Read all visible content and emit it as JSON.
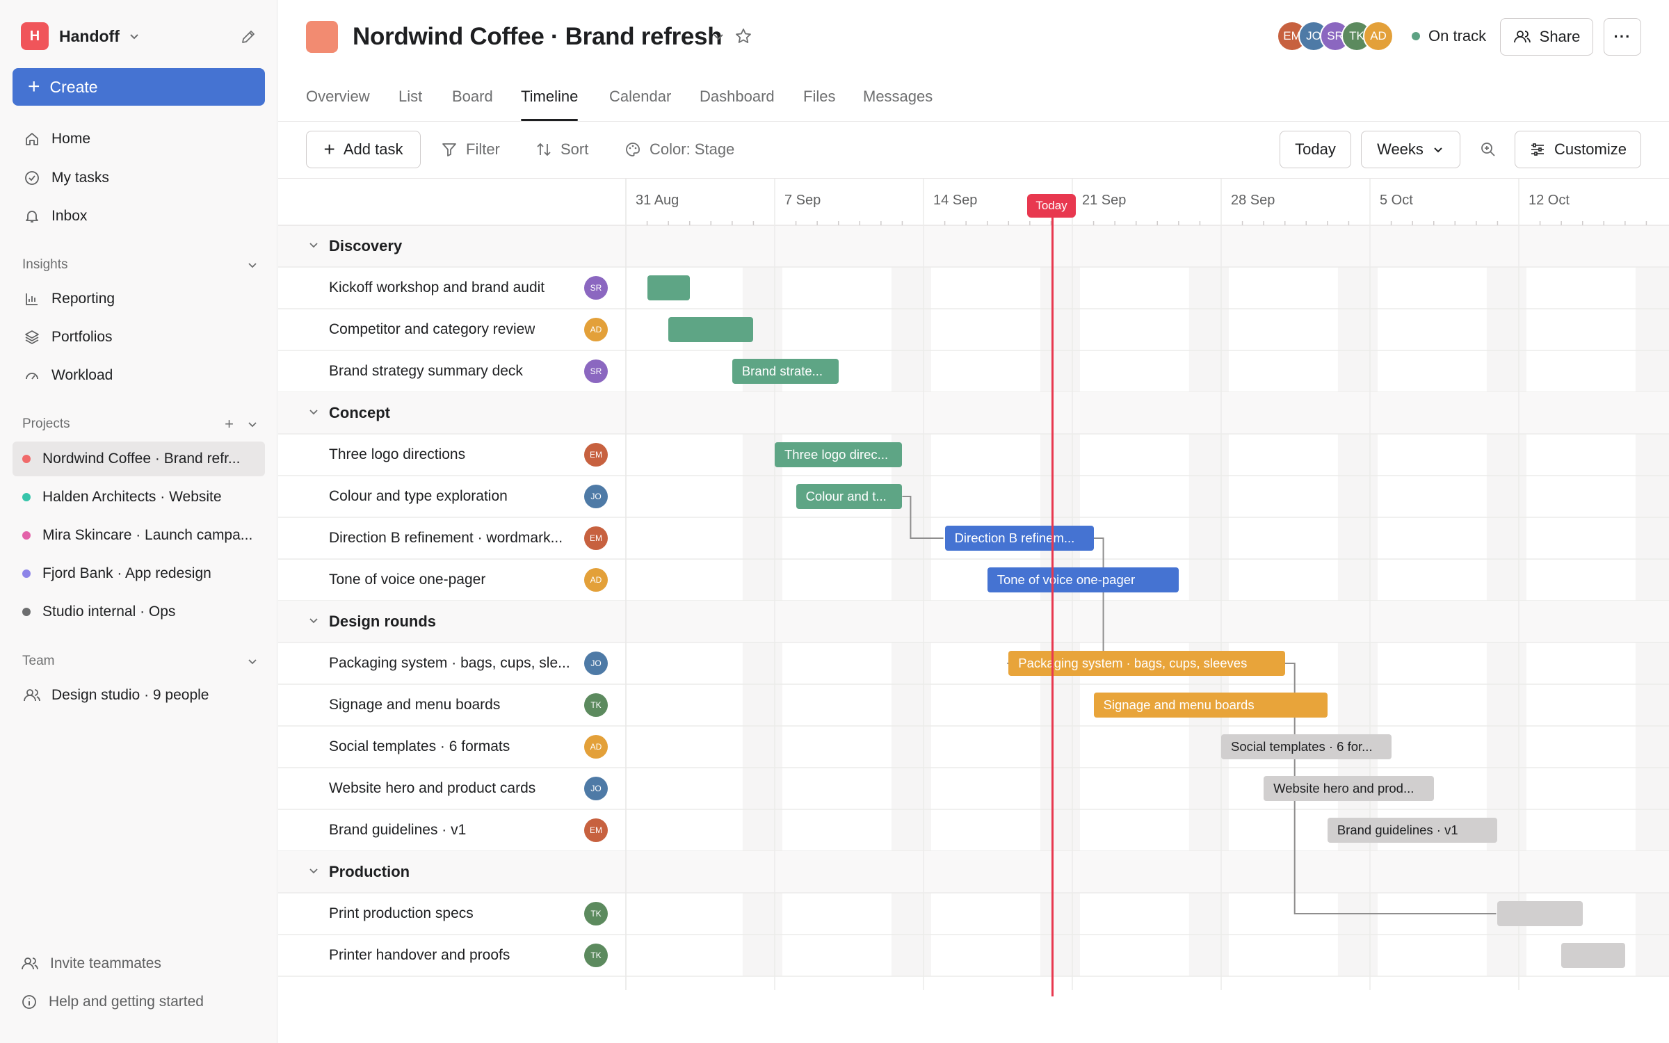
{
  "workspace": {
    "logo_letter": "H",
    "name": "Handoff"
  },
  "sidebar": {
    "create_label": "Create",
    "nav": [
      {
        "label": "Home",
        "icon": "home-icon"
      },
      {
        "label": "My tasks",
        "icon": "check-circle-icon"
      },
      {
        "label": "Inbox",
        "icon": "bell-icon"
      }
    ],
    "insights_header": "Insights",
    "insights": [
      {
        "label": "Reporting",
        "icon": "chart-icon"
      },
      {
        "label": "Portfolios",
        "icon": "layers-icon"
      },
      {
        "label": "Workload",
        "icon": "gauge-icon"
      }
    ],
    "projects_header": "Projects",
    "projects": [
      {
        "label": "Nordwind Coffee · Brand refr...",
        "color": "#f06a6a",
        "active": true
      },
      {
        "label": "Halden Architects · Website",
        "color": "#37c5ab",
        "active": false
      },
      {
        "label": "Mira Skincare · Launch campa...",
        "color": "#e362a9",
        "active": false
      },
      {
        "label": "Fjord Bank · App redesign",
        "color": "#8d84e8",
        "active": false
      },
      {
        "label": "Studio internal · Ops",
        "color": "#6d6e6f",
        "active": false
      }
    ],
    "team_header": "Team",
    "team": [
      {
        "label": "Design studio · 9 people",
        "icon": "people-icon"
      }
    ],
    "footer": [
      {
        "label": "Invite teammates",
        "icon": "invite-icon"
      },
      {
        "label": "Help and getting started",
        "icon": "info-icon"
      }
    ]
  },
  "header": {
    "title": "Nordwind Coffee · Brand refresh",
    "project_color": "#f28b71",
    "members": [
      {
        "initials": "EM",
        "color": "#c7613f"
      },
      {
        "initials": "JO",
        "color": "#4e7aa6"
      },
      {
        "initials": "SR",
        "color": "#8b67c0"
      },
      {
        "initials": "TK",
        "color": "#5c8a5e"
      },
      {
        "initials": "AD",
        "color": "#e3a039"
      }
    ],
    "status": "On track",
    "status_color": "#5da283",
    "share_label": "Share"
  },
  "tabs": [
    {
      "label": "Overview",
      "active": false
    },
    {
      "label": "List",
      "active": false
    },
    {
      "label": "Board",
      "active": false
    },
    {
      "label": "Timeline",
      "active": true
    },
    {
      "label": "Calendar",
      "active": false
    },
    {
      "label": "Dashboard",
      "active": false
    },
    {
      "label": "Files",
      "active": false
    },
    {
      "label": "Messages",
      "active": false
    }
  ],
  "toolbar": {
    "add_task": "Add task",
    "filter": "Filter",
    "sort": "Sort",
    "color": "Color: Stage",
    "today": "Today",
    "scale": "Weeks",
    "customize": "Customize"
  },
  "timeline": {
    "weeks": [
      "31 Aug",
      "7 Sep",
      "14 Sep",
      "21 Sep",
      "28 Sep",
      "5 Oct",
      "12 Oct"
    ],
    "today_label": "Today",
    "stage_colors": {
      "Discovery": "#5ea585",
      "Concept": "#5ea585",
      "Direction": "#4573d2",
      "Design": "#e8a43a",
      "Later": "#d1cfcf"
    },
    "sections": [
      {
        "name": "Discovery",
        "tasks": [
          {
            "name": "Kickoff workshop and brand audit",
            "assignee": "SR",
            "bar_label": ""
          },
          {
            "name": "Competitor and category review",
            "assignee": "AD",
            "bar_label": ""
          },
          {
            "name": "Brand strategy summary deck",
            "assignee": "SR",
            "bar_label": "Brand strate..."
          }
        ]
      },
      {
        "name": "Concept",
        "tasks": [
          {
            "name": "Three logo directions",
            "assignee": "EM",
            "bar_label": "Three logo direc..."
          },
          {
            "name": "Colour and type exploration",
            "assignee": "JO",
            "bar_label": "Colour and t..."
          },
          {
            "name": "Direction B refinement · wordmark...",
            "assignee": "EM",
            "bar_label": "Direction B refinem..."
          },
          {
            "name": "Tone of voice one-pager",
            "assignee": "AD",
            "bar_label": "Tone of voice one-pager"
          }
        ]
      },
      {
        "name": "Design rounds",
        "tasks": [
          {
            "name": "Packaging system · bags, cups, sle...",
            "assignee": "JO",
            "bar_label": "Packaging system · bags, cups, sleeves"
          },
          {
            "name": "Signage and menu boards",
            "assignee": "TK",
            "bar_label": "Signage and menu boards"
          },
          {
            "name": "Social templates · 6 formats",
            "assignee": "AD",
            "bar_label": "Social templates · 6 for..."
          },
          {
            "name": "Website hero and product cards",
            "assignee": "JO",
            "bar_label": "Website hero and prod..."
          },
          {
            "name": "Brand guidelines · v1",
            "assignee": "EM",
            "bar_label": "Brand guidelines · v1"
          }
        ]
      },
      {
        "name": "Production",
        "tasks": [
          {
            "name": "Print production specs",
            "assignee": "TK",
            "bar_label": ""
          },
          {
            "name": "Printer handover and proofs",
            "assignee": "TK",
            "bar_label": ""
          }
        ]
      }
    ]
  }
}
